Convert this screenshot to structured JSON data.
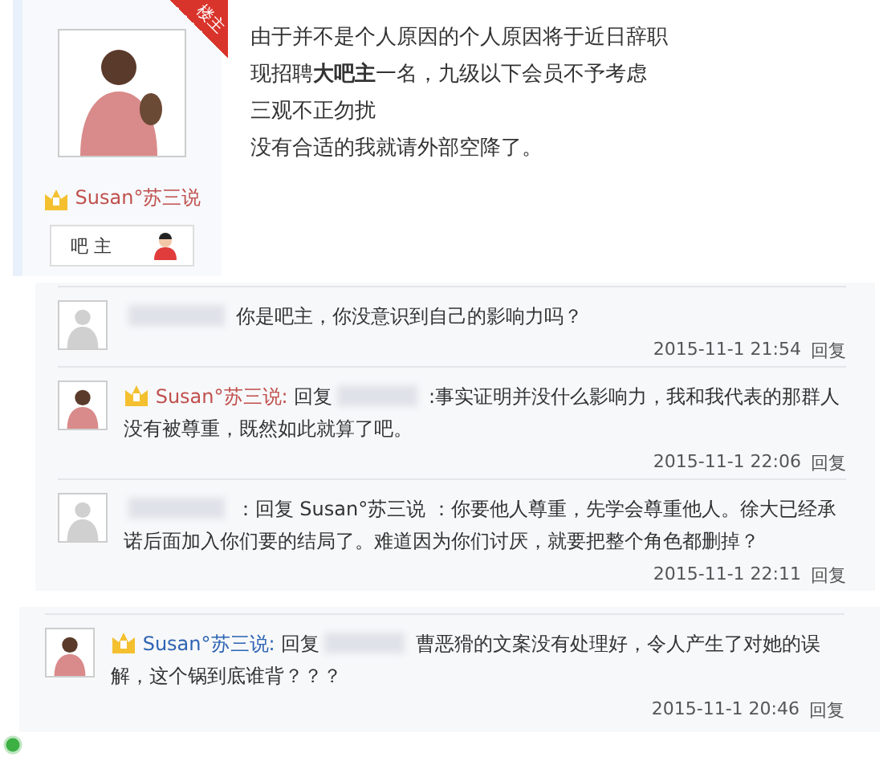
{
  "post": {
    "corner_badge": "楼主",
    "author": {
      "name": "Susan°苏三说",
      "color": "#c0504d"
    },
    "role": "吧 主",
    "lines": [
      "由于并不是个人原因的个人原因将于近日辞职",
      "现招聘**大吧主**一名，九级以下会员不予考虑",
      "三观不正勿扰",
      "没有合适的我就请外部空降了。"
    ]
  },
  "comment_groups": [
    {
      "comments": [
        {
          "text": "你是吧主，你没意识到自己的影响力吗？",
          "time": "2015-11-1 21:54",
          "reply_button": "回复"
        },
        {
          "author": {
            "name": "Susan°苏三说:",
            "color": "#c0504d"
          },
          "reply_to": {
            "label": "回复"
          },
          "text": ":事实证明并没什么影响力，我和我代表的那群人没有被尊重，既然如此就算了吧。",
          "time": "2015-11-1 22:06",
          "reply_button": "回复"
        },
        {
          "text": "：回复 Susan°苏三说 ：你要他人尊重，先学会尊重他人。徐大已经承诺后面加入你们要的结局了。难道因为你们讨厌，就要把整个角色都删掉？",
          "time": "2015-11-1 22:11",
          "reply_button": "回复"
        }
      ]
    },
    {
      "comments": [
        {
          "author": {
            "name": "Susan°苏三说:",
            "color": "#2d64b3"
          },
          "reply_to": {
            "label": "回复"
          },
          "text": "曹恶猾的文案没有处理好，令人产生了对她的误解，这个锅到底谁背？？？",
          "time": "2015-11-1 20:46",
          "reply_button": "回复"
        }
      ]
    }
  ]
}
